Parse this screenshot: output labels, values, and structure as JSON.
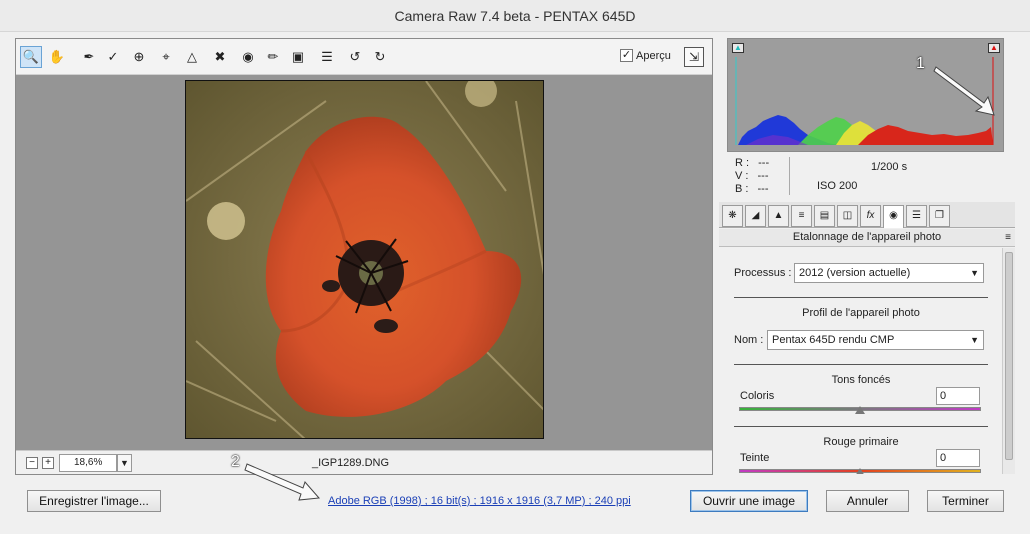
{
  "window": {
    "title": "Camera Raw 7.4 beta  -  PENTAX 645D"
  },
  "toolbar": {
    "tools": [
      "zoom-icon",
      "hand-icon",
      "white-balance-icon",
      "color-sampler-icon",
      "target-adjustment-icon",
      "crop-icon",
      "straighten-icon",
      "spot-removal-icon",
      "red-eye-icon",
      "adjustment-brush-icon",
      "graduated-filter-icon",
      "preferences-icon",
      "rotate-left-icon",
      "rotate-right-icon"
    ],
    "preview_label": "Aperçu",
    "preview_checked": true
  },
  "status": {
    "zoom_value": "18,6%",
    "filename": "_IGP1289.DNG"
  },
  "readout": {
    "r_label": "R :",
    "r_value": "---",
    "v_label": "V :",
    "v_value": "---",
    "b_label": "B :",
    "b_value": "---",
    "shutter": "1/200 s",
    "iso": "ISO 200"
  },
  "tabs": [
    "basic-icon",
    "tone-curve-icon",
    "detail-icon",
    "hsl-icon",
    "split-toning-icon",
    "lens-corrections-icon",
    "effects-icon",
    "camera-calibration-icon",
    "presets-icon",
    "snapshots-icon"
  ],
  "panel": {
    "title": "Etalonnage de l'appareil photo",
    "process_label": "Processus :",
    "process_value": "2012 (version actuelle)",
    "profile_section": "Profil de l'appareil photo",
    "name_label": "Nom :",
    "name_value": "Pentax 645D rendu CMP",
    "shadows_section": "Tons foncés",
    "tint_label": "Coloris",
    "tint_value": "0",
    "red_primary_section": "Rouge primaire",
    "hue_label": "Teinte",
    "hue_value": "0"
  },
  "footer": {
    "save_label": "Enregistrer l'image...",
    "workflow_link": "Adobe RGB (1998) ; 16 bit(s) ; 1916 x 1916 (3,7 MP) ; 240 ppi",
    "open_label": "Ouvrir une image",
    "cancel_label": "Annuler",
    "done_label": "Terminer"
  },
  "annotations": {
    "marker_1": "1",
    "marker_2": "2"
  },
  "colors": {
    "accent": "#3d7bbf",
    "link": "#1a3fb6",
    "canvas": "#959595"
  }
}
